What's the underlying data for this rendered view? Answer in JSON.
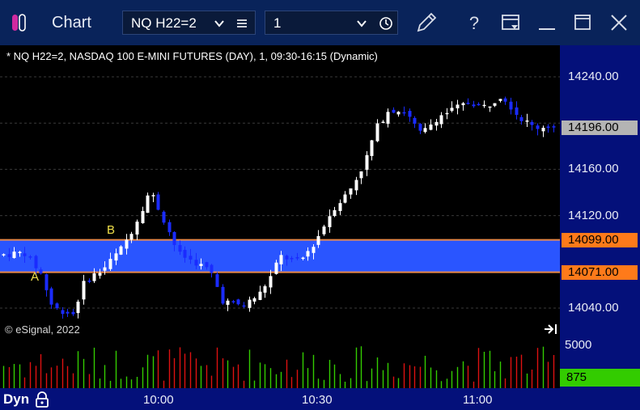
{
  "titlebar": {
    "title": "Chart",
    "symbol": "NQ H22=2",
    "interval": "1",
    "icons": [
      "app-icon",
      "chevron-down-icon",
      "menu-icon",
      "chevron-down-icon",
      "clock-icon",
      "pencil-icon",
      "help-icon",
      "window-menu-icon",
      "minimize-icon",
      "maximize-icon",
      "close-icon"
    ],
    "help_label": "?"
  },
  "chart": {
    "header": "* NQ H22=2, NASDAQ 100 E-MINI FUTURES (DAY), 1, 09:30-16:15 (Dynamic)",
    "copyright": "© eSignal, 2022",
    "zone_label_a": "A",
    "zone_label_b": "B",
    "dyn_label": "Dyn"
  },
  "chart_data": {
    "type": "candlestick",
    "price_axis_ticks": [
      "14240.00",
      "14200.00",
      "14160.00",
      "14120.00",
      "14080.00",
      "14040.00"
    ],
    "price_ticks_values": [
      14240,
      14200,
      14160,
      14120,
      14080,
      14040
    ],
    "price_labels": {
      "last": "14196.00",
      "zone_top": "14099.00",
      "zone_bottom": "14071.00"
    },
    "zone": {
      "top": 14099,
      "bottom": 14071,
      "fill": "#2a55ff",
      "border": "#e8884a"
    },
    "volume_ticks": [
      "5000"
    ],
    "volume_last": "875",
    "time_ticks": [
      "10:00",
      "10:30",
      "11:00"
    ],
    "ylim": [
      14020,
      14280
    ],
    "colors": {
      "up": "#ffffff",
      "down": "#1a2bff",
      "vol_up": "#33cc00",
      "vol_down": "#dd1111",
      "axis_bg": "#04107a",
      "last_bg": "#b4b4b4",
      "zone_label_bg": "#ff7a1a"
    }
  }
}
